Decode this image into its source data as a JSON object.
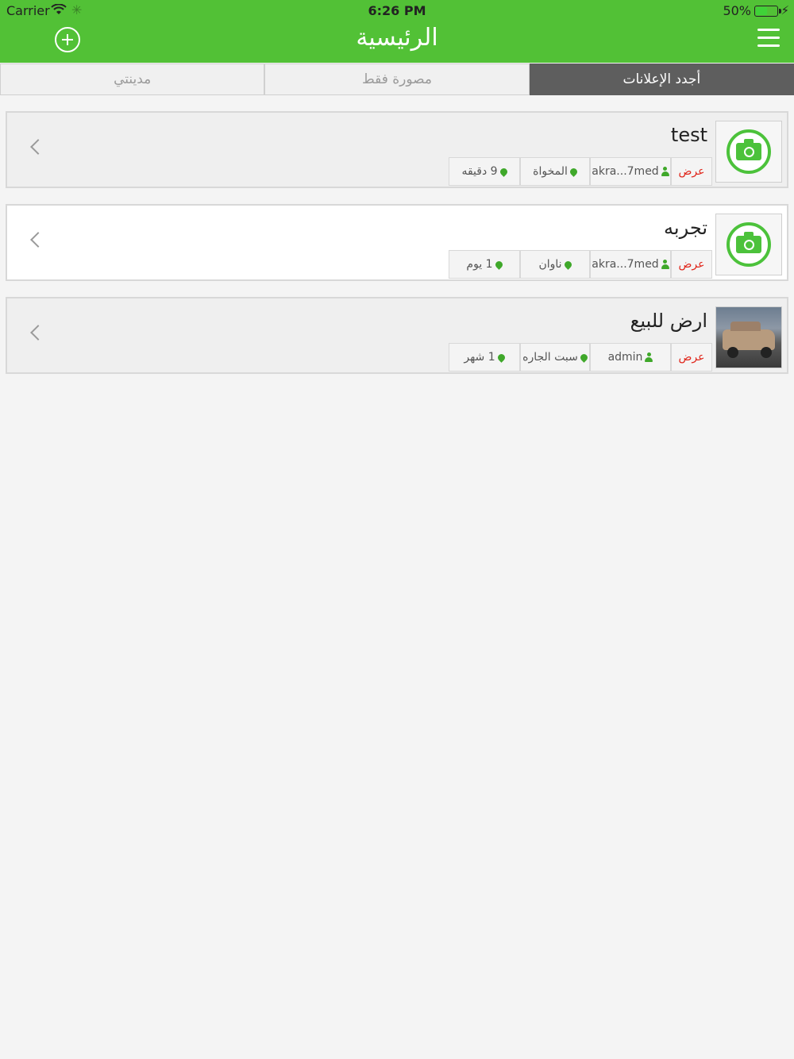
{
  "status_bar": {
    "carrier": "Carrier",
    "time": "6:26 PM",
    "battery": "50%"
  },
  "nav": {
    "title": "الرئيسية",
    "add_icon": "plus-circle-icon",
    "menu_icon": "hamburger-menu-icon"
  },
  "tabs": [
    {
      "label": "أجدد الإعلانات",
      "active": true
    },
    {
      "label": "مصورة فقط",
      "active": false
    },
    {
      "label": "مدينتي",
      "active": false
    }
  ],
  "ads": [
    {
      "title": "test",
      "view_label": "عرض",
      "user": "akra...7med",
      "location": "المخواة",
      "age": "9 دقيقه",
      "thumbnail": "camera-placeholder-icon"
    },
    {
      "title": "تجربه",
      "view_label": "عرض",
      "user": "akra...7med",
      "location": "ناوان",
      "age": "1 يوم",
      "thumbnail": "camera-placeholder-icon"
    },
    {
      "title": "ارض للبيع",
      "view_label": "عرض",
      "user": "admin",
      "location": "سبت الجاره",
      "age": "1 شهر",
      "thumbnail": "car-photo"
    }
  ],
  "colors": {
    "primary_green": "#52c136",
    "active_tab": "#5e5e5e",
    "view_red": "#e0261b"
  }
}
